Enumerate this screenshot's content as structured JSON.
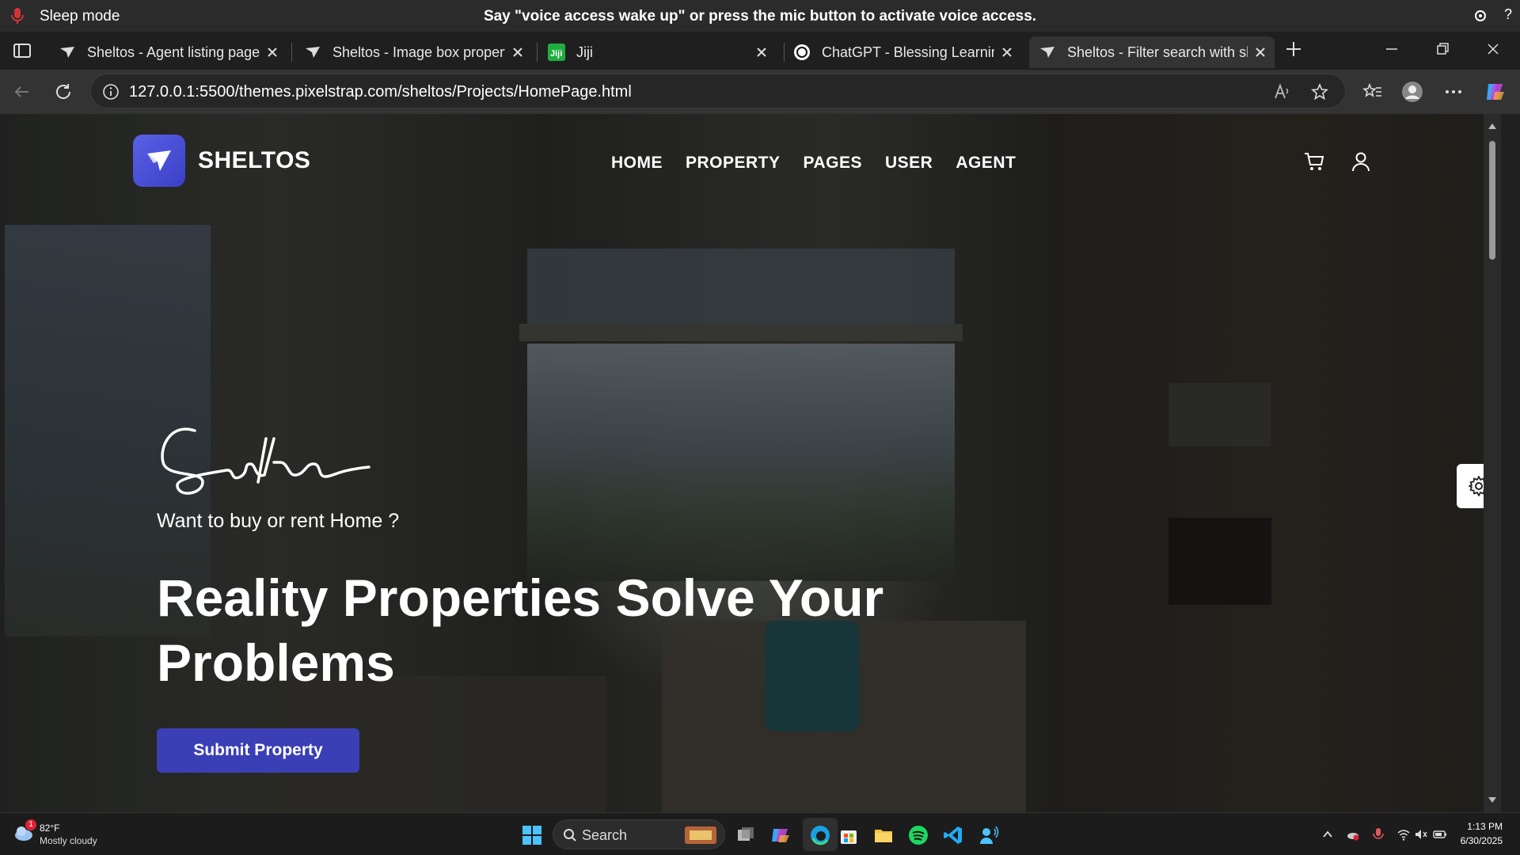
{
  "voice": {
    "mode": "Sleep mode",
    "message": "Say \"voice access wake up\" or press the mic button to activate voice access.",
    "help": "?"
  },
  "tabs": [
    {
      "title": "Sheltos - Agent listing page"
    },
    {
      "title": "Sheltos - Image box property"
    },
    {
      "title": "Jiji"
    },
    {
      "title": "ChatGPT - Blessing Learning"
    },
    {
      "title": "Sheltos - Filter search with slic"
    }
  ],
  "address": {
    "url": "127.0.0.1:5500/themes.pixelstrap.com/sheltos/Projects/HomePage.html"
  },
  "site": {
    "brand": "SHELTOS",
    "nav": [
      "HOME",
      "PROPERTY",
      "PAGES",
      "USER",
      "AGENT"
    ],
    "hero_sub": "Want to buy or rent Home ?",
    "hero_title_line1": "Reality Properties Solve Your",
    "hero_title_line2": "Problems",
    "cta": "Submit Property",
    "colors": {
      "accent": "#3b3fb5",
      "logo": "#5961e6"
    }
  },
  "taskbar": {
    "weather_temp": "82°F",
    "weather_cond": "Mostly cloudy",
    "weather_badge": "1",
    "search": "Search",
    "time": "1:13 PM",
    "date": "6/30/2025"
  }
}
